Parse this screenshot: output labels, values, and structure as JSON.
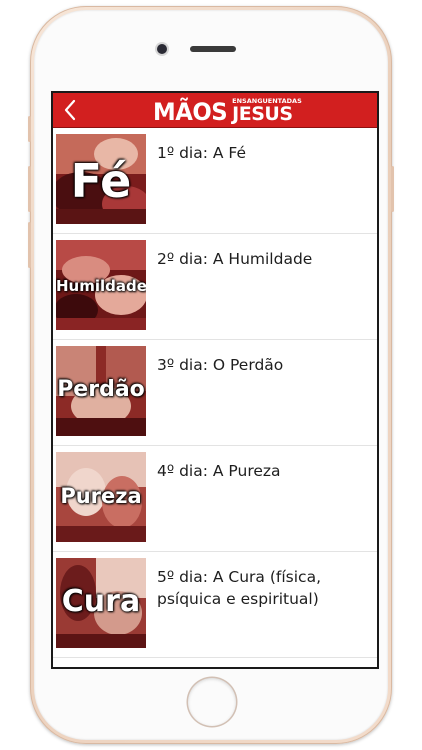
{
  "header": {
    "back_icon": "chevron-left-icon",
    "logo": {
      "line1": "MÃOS",
      "line2_top": "ENSANGUENTADAS",
      "line2_bottom": "JESUS"
    }
  },
  "colors": {
    "accent": "#d21f1f",
    "text": "#1e1e1e"
  },
  "days": [
    {
      "title": "1º dia: A Fé",
      "thumb_word": "Fé"
    },
    {
      "title": "2º dia: A Humildade",
      "thumb_word": "Humildade"
    },
    {
      "title": "3º dia: O Perdão",
      "thumb_word": "Perdão"
    },
    {
      "title": "4º dia: A Pureza",
      "thumb_word": "Pureza"
    },
    {
      "title": "5º dia: A Cura (física, psíquica e espiritual)",
      "thumb_word": "Cura"
    }
  ]
}
